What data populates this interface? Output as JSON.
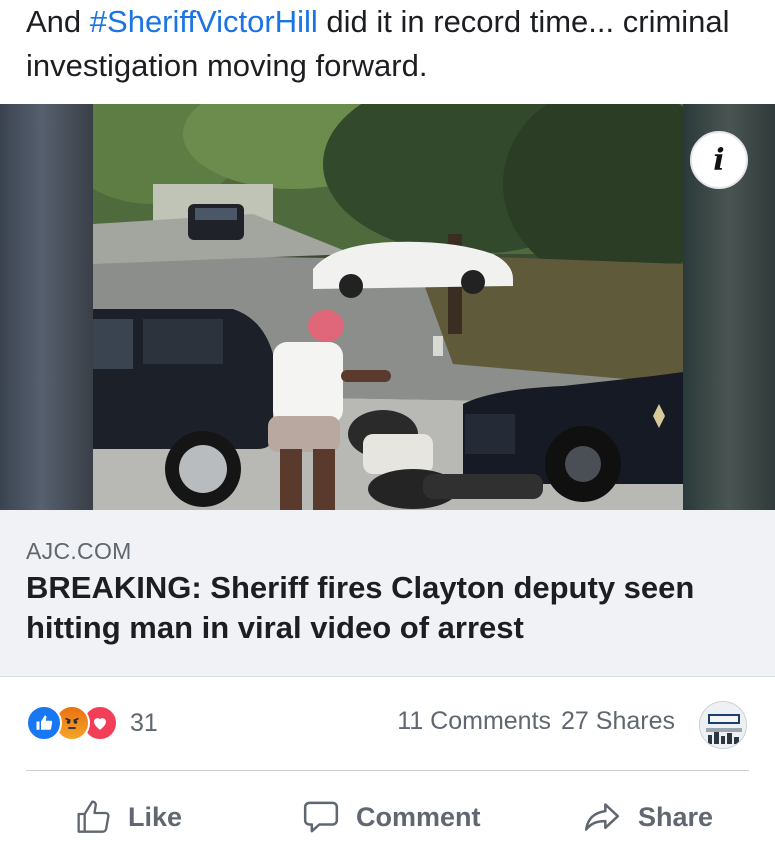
{
  "post": {
    "text_prefix": "And ",
    "hashtag": "#SheriffVictorHill",
    "text_suffix": " did it in record time... criminal investigation moving forward."
  },
  "media": {
    "info_icon": "info-icon",
    "info_glyph": "i"
  },
  "link_preview": {
    "domain": "AJC.COM",
    "title": "BREAKING: Sheriff fires Clayton deputy seen hitting man in viral video of arrest"
  },
  "reactions": {
    "icons": [
      "like-reaction-icon",
      "angry-reaction-icon",
      "love-reaction-icon"
    ],
    "count": "31",
    "comments": "11 Comments",
    "shares": "27 Shares"
  },
  "actions": {
    "like": "Like",
    "comment": "Comment",
    "share": "Share"
  },
  "colors": {
    "hashtag": "#1b74e4",
    "like_blue": "#1877f2",
    "love_red": "#f33e58",
    "muted_text": "#606770",
    "card_bg": "#f0f2f5"
  }
}
